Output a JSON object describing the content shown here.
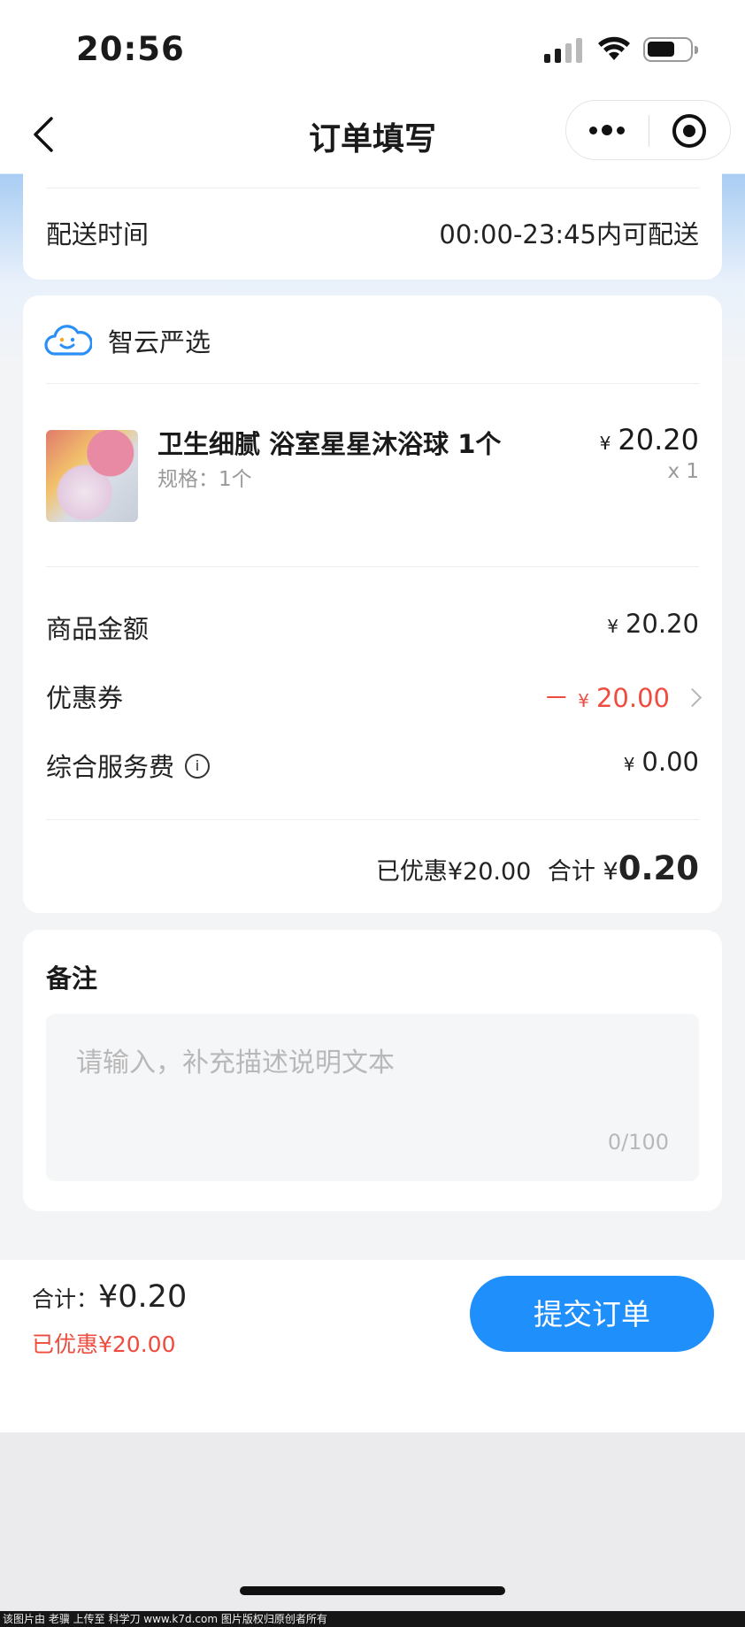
{
  "status_bar": {
    "time": "20:56"
  },
  "nav": {
    "title": "订单填写"
  },
  "delivery": {
    "label": "配送时间",
    "value": "00:00-23:45内可配送"
  },
  "shop": {
    "name": "智云严选",
    "icon": "cloud-smile-icon"
  },
  "product": {
    "name": "卫生细腻 浴室星星沐浴球 1个",
    "spec": "规格：1个",
    "currency": "¥",
    "price": "20.20",
    "qty": "x 1"
  },
  "pricing": {
    "goods_label": "商品金额",
    "goods_currency": "¥",
    "goods_value": "20.20",
    "coupon_label": "优惠券",
    "coupon_prefix": "－",
    "coupon_currency": "¥",
    "coupon_value": "20.00",
    "service_label": "综合服务费",
    "service_info_icon": "i",
    "service_currency": "¥",
    "service_value": "0.00",
    "summary_saved": "已优惠¥20.00",
    "summary_total_label": "合计",
    "summary_currency": "¥",
    "summary_total": "0.20"
  },
  "remark": {
    "title": "备注",
    "placeholder": "请输入，补充描述说明文本",
    "count": "0/100"
  },
  "bottom": {
    "total_label": "合计：",
    "total_value": "¥0.20",
    "saved": "已优惠¥20.00",
    "submit_label": "提交订单"
  },
  "colors": {
    "accent": "#1f8ffb",
    "discount": "#ef4b3f"
  },
  "watermark": "该图片由 老骥 上传至 科学刀 www.k7d.com 图片版权归原创者所有"
}
